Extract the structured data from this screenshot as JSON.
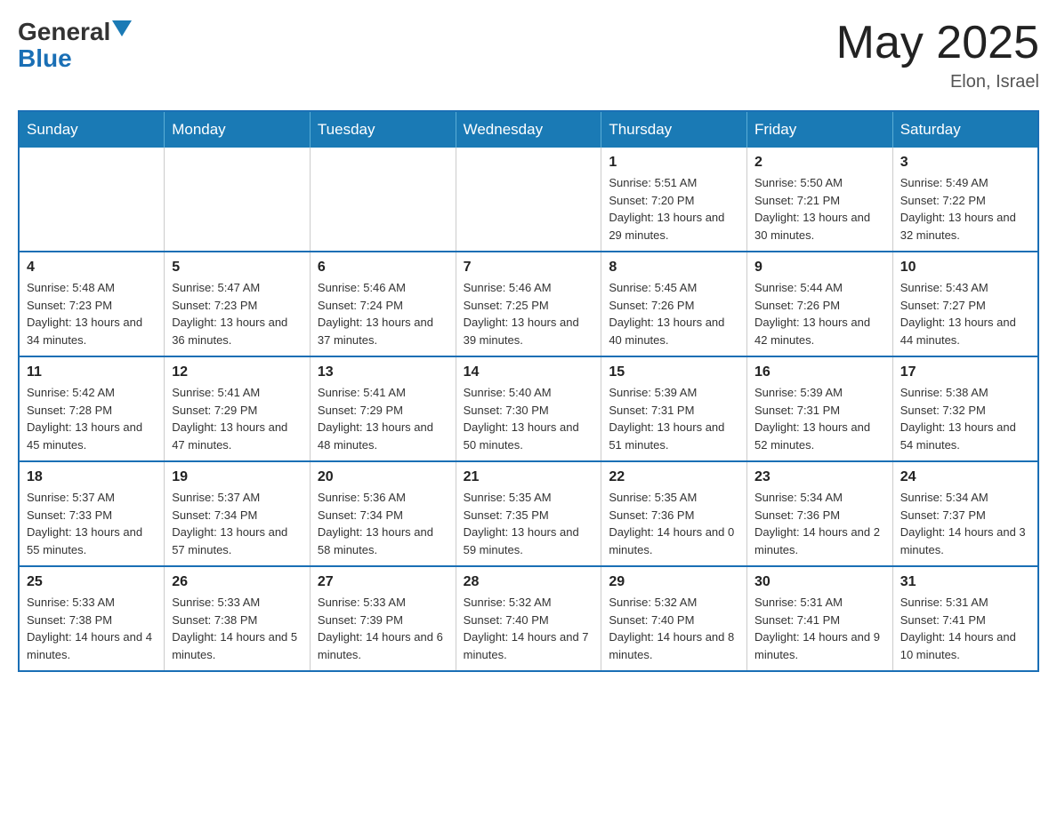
{
  "header": {
    "logo_general": "General",
    "logo_blue": "Blue",
    "month_year": "May 2025",
    "location": "Elon, Israel"
  },
  "weekdays": [
    "Sunday",
    "Monday",
    "Tuesday",
    "Wednesday",
    "Thursday",
    "Friday",
    "Saturday"
  ],
  "weeks": [
    [
      {
        "day": "",
        "info": ""
      },
      {
        "day": "",
        "info": ""
      },
      {
        "day": "",
        "info": ""
      },
      {
        "day": "",
        "info": ""
      },
      {
        "day": "1",
        "info": "Sunrise: 5:51 AM\nSunset: 7:20 PM\nDaylight: 13 hours and 29 minutes."
      },
      {
        "day": "2",
        "info": "Sunrise: 5:50 AM\nSunset: 7:21 PM\nDaylight: 13 hours and 30 minutes."
      },
      {
        "day": "3",
        "info": "Sunrise: 5:49 AM\nSunset: 7:22 PM\nDaylight: 13 hours and 32 minutes."
      }
    ],
    [
      {
        "day": "4",
        "info": "Sunrise: 5:48 AM\nSunset: 7:23 PM\nDaylight: 13 hours and 34 minutes."
      },
      {
        "day": "5",
        "info": "Sunrise: 5:47 AM\nSunset: 7:23 PM\nDaylight: 13 hours and 36 minutes."
      },
      {
        "day": "6",
        "info": "Sunrise: 5:46 AM\nSunset: 7:24 PM\nDaylight: 13 hours and 37 minutes."
      },
      {
        "day": "7",
        "info": "Sunrise: 5:46 AM\nSunset: 7:25 PM\nDaylight: 13 hours and 39 minutes."
      },
      {
        "day": "8",
        "info": "Sunrise: 5:45 AM\nSunset: 7:26 PM\nDaylight: 13 hours and 40 minutes."
      },
      {
        "day": "9",
        "info": "Sunrise: 5:44 AM\nSunset: 7:26 PM\nDaylight: 13 hours and 42 minutes."
      },
      {
        "day": "10",
        "info": "Sunrise: 5:43 AM\nSunset: 7:27 PM\nDaylight: 13 hours and 44 minutes."
      }
    ],
    [
      {
        "day": "11",
        "info": "Sunrise: 5:42 AM\nSunset: 7:28 PM\nDaylight: 13 hours and 45 minutes."
      },
      {
        "day": "12",
        "info": "Sunrise: 5:41 AM\nSunset: 7:29 PM\nDaylight: 13 hours and 47 minutes."
      },
      {
        "day": "13",
        "info": "Sunrise: 5:41 AM\nSunset: 7:29 PM\nDaylight: 13 hours and 48 minutes."
      },
      {
        "day": "14",
        "info": "Sunrise: 5:40 AM\nSunset: 7:30 PM\nDaylight: 13 hours and 50 minutes."
      },
      {
        "day": "15",
        "info": "Sunrise: 5:39 AM\nSunset: 7:31 PM\nDaylight: 13 hours and 51 minutes."
      },
      {
        "day": "16",
        "info": "Sunrise: 5:39 AM\nSunset: 7:31 PM\nDaylight: 13 hours and 52 minutes."
      },
      {
        "day": "17",
        "info": "Sunrise: 5:38 AM\nSunset: 7:32 PM\nDaylight: 13 hours and 54 minutes."
      }
    ],
    [
      {
        "day": "18",
        "info": "Sunrise: 5:37 AM\nSunset: 7:33 PM\nDaylight: 13 hours and 55 minutes."
      },
      {
        "day": "19",
        "info": "Sunrise: 5:37 AM\nSunset: 7:34 PM\nDaylight: 13 hours and 57 minutes."
      },
      {
        "day": "20",
        "info": "Sunrise: 5:36 AM\nSunset: 7:34 PM\nDaylight: 13 hours and 58 minutes."
      },
      {
        "day": "21",
        "info": "Sunrise: 5:35 AM\nSunset: 7:35 PM\nDaylight: 13 hours and 59 minutes."
      },
      {
        "day": "22",
        "info": "Sunrise: 5:35 AM\nSunset: 7:36 PM\nDaylight: 14 hours and 0 minutes."
      },
      {
        "day": "23",
        "info": "Sunrise: 5:34 AM\nSunset: 7:36 PM\nDaylight: 14 hours and 2 minutes."
      },
      {
        "day": "24",
        "info": "Sunrise: 5:34 AM\nSunset: 7:37 PM\nDaylight: 14 hours and 3 minutes."
      }
    ],
    [
      {
        "day": "25",
        "info": "Sunrise: 5:33 AM\nSunset: 7:38 PM\nDaylight: 14 hours and 4 minutes."
      },
      {
        "day": "26",
        "info": "Sunrise: 5:33 AM\nSunset: 7:38 PM\nDaylight: 14 hours and 5 minutes."
      },
      {
        "day": "27",
        "info": "Sunrise: 5:33 AM\nSunset: 7:39 PM\nDaylight: 14 hours and 6 minutes."
      },
      {
        "day": "28",
        "info": "Sunrise: 5:32 AM\nSunset: 7:40 PM\nDaylight: 14 hours and 7 minutes."
      },
      {
        "day": "29",
        "info": "Sunrise: 5:32 AM\nSunset: 7:40 PM\nDaylight: 14 hours and 8 minutes."
      },
      {
        "day": "30",
        "info": "Sunrise: 5:31 AM\nSunset: 7:41 PM\nDaylight: 14 hours and 9 minutes."
      },
      {
        "day": "31",
        "info": "Sunrise: 5:31 AM\nSunset: 7:41 PM\nDaylight: 14 hours and 10 minutes."
      }
    ]
  ]
}
